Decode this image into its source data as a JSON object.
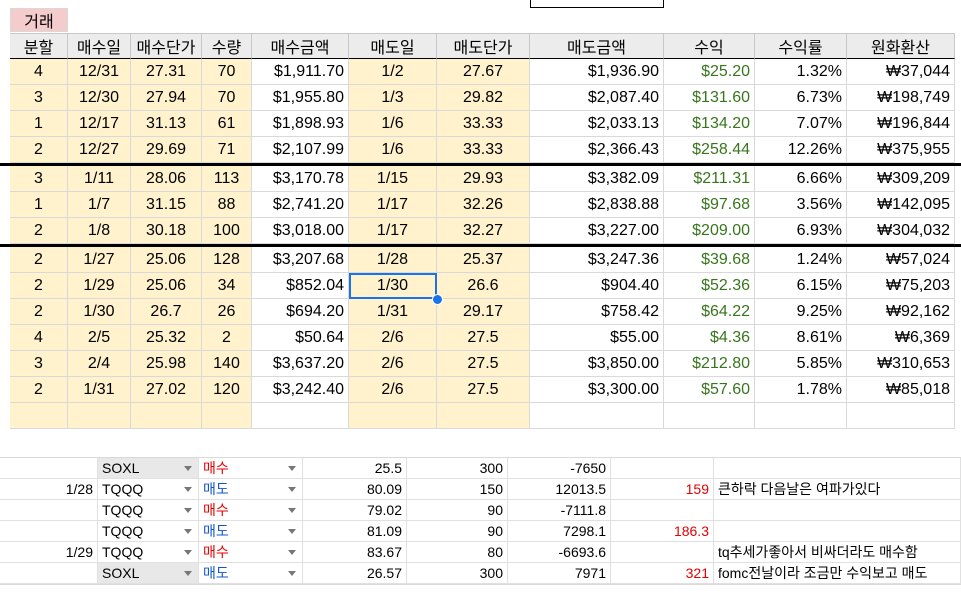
{
  "sheet": {
    "section_label": "거래",
    "headers": [
      "분할",
      "매수일",
      "매수단가",
      "수량",
      "매수금액",
      "매도일",
      "매도단가",
      "매도금액",
      "수익",
      "수익률",
      "원화환산"
    ],
    "rows": [
      [
        "4",
        "12/31",
        "27.31",
        "70",
        "$1,911.70",
        "1/2",
        "27.67",
        "$1,936.90",
        "$25.20",
        "1.32%",
        "₩37,044"
      ],
      [
        "3",
        "12/30",
        "27.94",
        "70",
        "$1,955.80",
        "1/3",
        "29.82",
        "$2,087.40",
        "$131.60",
        "6.73%",
        "₩198,749"
      ],
      [
        "1",
        "12/17",
        "31.13",
        "61",
        "$1,898.93",
        "1/6",
        "33.33",
        "$2,033.13",
        "$134.20",
        "7.07%",
        "₩196,844"
      ],
      [
        "2",
        "12/27",
        "29.69",
        "71",
        "$2,107.99",
        "1/6",
        "33.33",
        "$2,366.43",
        "$258.44",
        "12.26%",
        "₩375,955"
      ],
      [
        "3",
        "1/11",
        "28.06",
        "113",
        "$3,170.78",
        "1/15",
        "29.93",
        "$3,382.09",
        "$211.31",
        "6.66%",
        "₩309,209"
      ],
      [
        "1",
        "1/7",
        "31.15",
        "88",
        "$2,741.20",
        "1/17",
        "32.26",
        "$2,838.88",
        "$97.68",
        "3.56%",
        "₩142,095"
      ],
      [
        "2",
        "1/8",
        "30.18",
        "100",
        "$3,018.00",
        "1/17",
        "32.27",
        "$3,227.00",
        "$209.00",
        "6.93%",
        "₩304,032"
      ],
      [
        "2",
        "1/27",
        "25.06",
        "128",
        "$3,207.68",
        "1/28",
        "25.37",
        "$3,247.36",
        "$39.68",
        "1.24%",
        "₩57,024"
      ],
      [
        "2",
        "1/29",
        "25.06",
        "34",
        "$852.04",
        "1/30",
        "26.6",
        "$904.40",
        "$52.36",
        "6.15%",
        "₩75,203"
      ],
      [
        "2",
        "1/30",
        "26.7",
        "26",
        "$694.20",
        "1/31",
        "29.17",
        "$758.42",
        "$64.22",
        "9.25%",
        "₩92,162"
      ],
      [
        "4",
        "2/5",
        "25.32",
        "2",
        "$50.64",
        "2/6",
        "27.5",
        "$55.00",
        "$4.36",
        "8.61%",
        "₩6,369"
      ],
      [
        "3",
        "2/4",
        "25.98",
        "140",
        "$3,637.20",
        "2/6",
        "27.5",
        "$3,850.00",
        "$212.80",
        "5.85%",
        "₩310,653"
      ],
      [
        "2",
        "1/31",
        "27.02",
        "120",
        "$3,242.40",
        "2/6",
        "27.5",
        "$3,300.00",
        "$57.60",
        "1.78%",
        "₩85,018"
      ]
    ],
    "selected_cell": "1/30"
  },
  "log": {
    "rows": [
      {
        "date": "",
        "ticker": "SOXL",
        "action": "매수",
        "price": "25.5",
        "qty": "300",
        "amount": "-7650",
        "profit": "",
        "profit2": "",
        "note": ""
      },
      {
        "date": "1/28",
        "ticker": "TQQQ",
        "action": "매도",
        "price": "80.09",
        "qty": "150",
        "amount": "12013.5",
        "profit": "",
        "profit2": "159",
        "note": "큰하락 다음날은 여파가있다"
      },
      {
        "date": "",
        "ticker": "TQQQ",
        "action": "매수",
        "price": "79.02",
        "qty": "90",
        "amount": "-7111.8",
        "profit": "",
        "profit2": "",
        "note": ""
      },
      {
        "date": "",
        "ticker": "TQQQ",
        "action": "매도",
        "price": "81.09",
        "qty": "90",
        "amount": "7298.1",
        "profit": "186.3",
        "profit2": "",
        "note": ""
      },
      {
        "date": "1/29",
        "ticker": "TQQQ",
        "action": "매수",
        "price": "83.67",
        "qty": "80",
        "amount": "-6693.6",
        "profit": "",
        "profit2": "",
        "note": "tq추세가좋아서 비싸더라도 매수함"
      },
      {
        "date": "",
        "ticker": "SOXL",
        "action": "매도",
        "price": "26.57",
        "qty": "300",
        "amount": "7971",
        "profit": "",
        "profit2": "321",
        "note": "fomc전날이라 조금만 수익보고 매도"
      }
    ]
  },
  "colors": {
    "beige": "#fff2cc",
    "header": "#ececec",
    "label": "#f4cccc",
    "profit_green": "#38761d",
    "buy_red": "#e60000",
    "sell_blue": "#1155cc",
    "selection": "#1a73e8"
  }
}
